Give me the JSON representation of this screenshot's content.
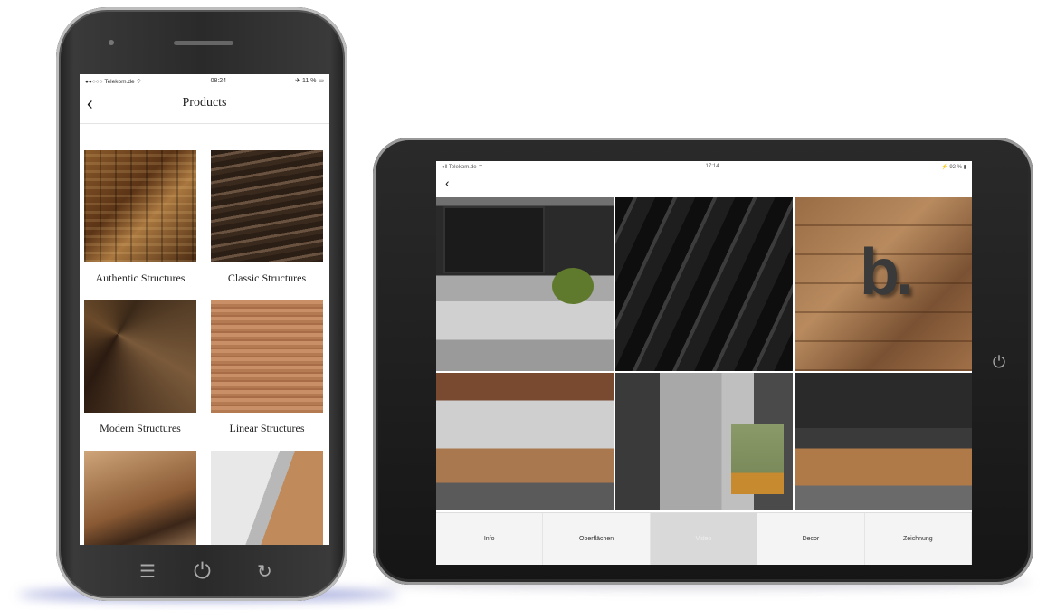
{
  "phone": {
    "status": {
      "carrier": "●●○○○ Telekom.de ⌔",
      "time": "08:24",
      "battery": "✈ 11 % ▭"
    },
    "nav": {
      "back_icon": "‹",
      "title": "Products"
    },
    "products": [
      {
        "label": "Authentic Structures",
        "texture": "tex-authentic"
      },
      {
        "label": "Classic Structures",
        "texture": "tex-classic"
      },
      {
        "label": "Modern Structures",
        "texture": "tex-modern"
      },
      {
        "label": "Linear Structures",
        "texture": "tex-linear"
      },
      {
        "label": "",
        "texture": "tex-plank"
      },
      {
        "label": "",
        "texture": "tex-panels"
      }
    ],
    "home": {
      "menu_icon": "☰",
      "power_icon": "⏻",
      "refresh_icon": "↻"
    }
  },
  "tablet": {
    "status": {
      "carrier": "●ll Telekom.de ⌔",
      "time": "17:14",
      "battery": "⚡ 92 % ▮"
    },
    "nav": {
      "back_icon": "‹"
    },
    "side_button_icon": "⏻",
    "photo_logo_text": "b.",
    "tabs": [
      {
        "label": "Info",
        "active": false
      },
      {
        "label": "Oberflächen",
        "active": false
      },
      {
        "label": "Video",
        "active": true
      },
      {
        "label": "Decor",
        "active": false
      },
      {
        "label": "Zeichnung",
        "active": false
      }
    ]
  }
}
